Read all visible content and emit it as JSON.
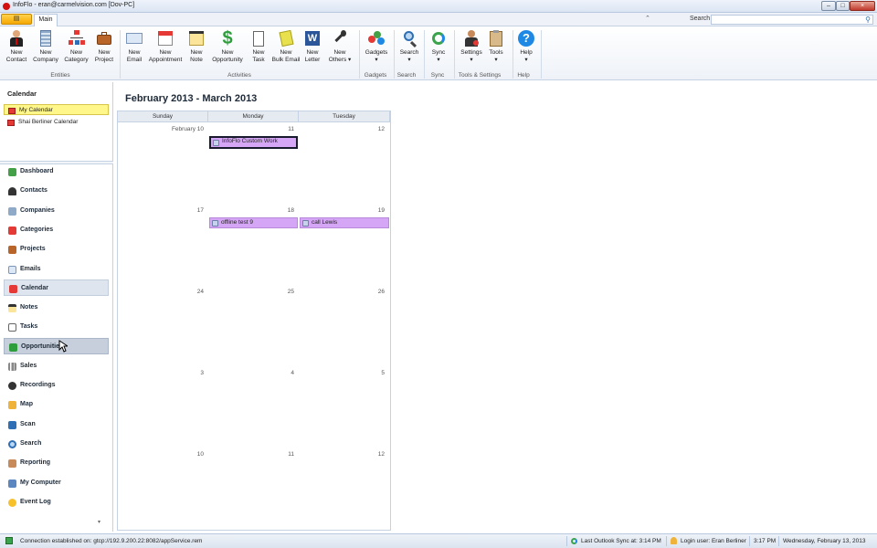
{
  "window": {
    "title": "InfoFlo - eran@carmelvision.com [Dov-PC]",
    "min": "–",
    "max": "□",
    "close": "×"
  },
  "tabs": {
    "app_menu": "▤",
    "main": "Main",
    "collapse": "⌃",
    "search_label": "Search",
    "search_placeholder": ""
  },
  "ribbon": {
    "buttons": [
      {
        "l1": "New",
        "l2": "Contact"
      },
      {
        "l1": "New",
        "l2": "Company"
      },
      {
        "l1": "New",
        "l2": "Category"
      },
      {
        "l1": "New",
        "l2": "Project"
      },
      {
        "l1": "New",
        "l2": "Email"
      },
      {
        "l1": "New",
        "l2": "Appointment"
      },
      {
        "l1": "New",
        "l2": "Note"
      },
      {
        "l1": "New",
        "l2": "Opportunity"
      },
      {
        "l1": "New",
        "l2": "Task"
      },
      {
        "l1": "New",
        "l2": "Bulk Email"
      },
      {
        "l1": "New",
        "l2": "Letter"
      },
      {
        "l1": "New",
        "l2": "Others ▾"
      },
      {
        "l1": "Gadgets",
        "l2": "▾"
      },
      {
        "l1": "Search",
        "l2": "▾"
      },
      {
        "l1": "Sync",
        "l2": "▾"
      },
      {
        "l1": "Settings",
        "l2": "▾"
      },
      {
        "l1": "Tools",
        "l2": "▾"
      },
      {
        "l1": "Help",
        "l2": "▾"
      }
    ],
    "groups": [
      "Entities",
      "Activities",
      "Gadgets",
      "Search",
      "Sync",
      "Tools & Settings",
      "Help"
    ]
  },
  "sidebar": {
    "calendar_title": "Calendar",
    "calendars": [
      "My Calendar",
      "Shai Berliner Calendar"
    ],
    "nav": [
      "Dashboard",
      "Contacts",
      "Companies",
      "Categories",
      "Projects",
      "Emails",
      "Calendar",
      "Notes",
      "Tasks",
      "Opportunities",
      "Sales",
      "Recordings",
      "Map",
      "Scan",
      "Search",
      "Reporting",
      "My Computer",
      "Event Log"
    ],
    "scroll_down": "▾"
  },
  "calendar": {
    "range": "February 2013 - March 2013",
    "days": [
      "Sunday",
      "Monday",
      "Tuesday"
    ],
    "weeks": [
      [
        "February 10",
        "11",
        "12"
      ],
      [
        "17",
        "18",
        "19"
      ],
      [
        "24",
        "25",
        "26"
      ],
      [
        "3",
        "4",
        "5"
      ],
      [
        "10",
        "11",
        "12"
      ]
    ],
    "events": [
      {
        "title": "InfoFlo Custom Work"
      },
      {
        "title": "offline test 9"
      },
      {
        "title": "call Lewis"
      }
    ]
  },
  "status": {
    "connection": "Connection established on: gtcp://192.9.200.22:8082/appService.rem",
    "sync": "Last Outlook Sync at: 3:14 PM",
    "login": "Login user: Eran Berliner",
    "time": "3:17 PM",
    "date": "Wednesday, February 13, 2013"
  },
  "colors": {
    "event": "#d6a6f6",
    "my_calendar": "#fff78a",
    "accent": "#2e6fb5"
  }
}
